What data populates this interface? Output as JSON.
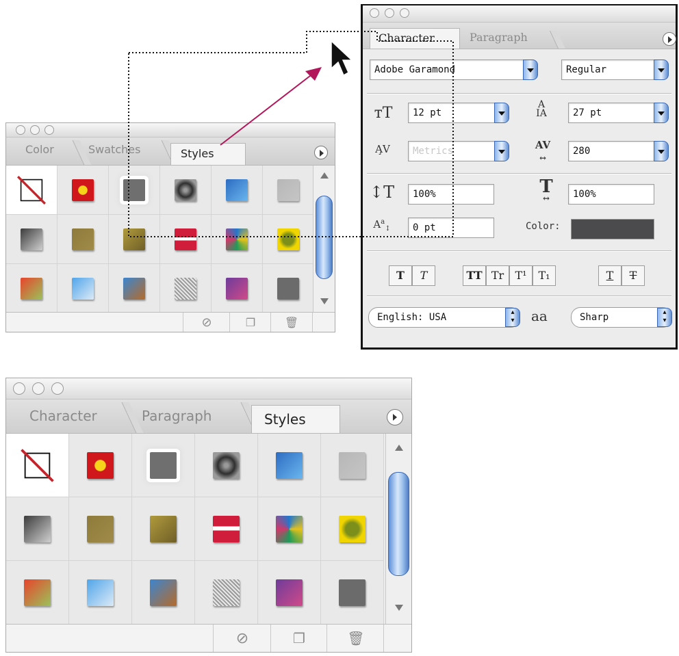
{
  "top_styles_panel": {
    "tabs": [
      "Color",
      "Swatches",
      "Styles"
    ],
    "active_tab": "Styles"
  },
  "character_panel": {
    "tabs": [
      "Character",
      "Paragraph"
    ],
    "active_tab": "Character",
    "font_family": "Adobe Garamond",
    "font_style": "Regular",
    "font_size": "12 pt",
    "leading": "27 pt",
    "kerning": "Metrics",
    "tracking": "280",
    "vertical_scale": "100%",
    "horizontal_scale": "100%",
    "baseline_shift": "0 pt",
    "color_label": "Color:",
    "color_value": "#4b4b4d",
    "type_buttons": [
      "T",
      "T",
      "TT",
      "Tr",
      "T¹",
      "T₁",
      "T",
      "T"
    ],
    "language": "English: USA",
    "aa_glyph": "aa",
    "anti_alias": "Sharp"
  },
  "bottom_styles_panel": {
    "tabs": [
      "Character",
      "Paragraph",
      "Styles"
    ],
    "active_tab": "Styles"
  },
  "styles": [
    {
      "name": "none",
      "colors": [
        "#ffffff",
        "#ffffff"
      ]
    },
    {
      "name": "red-yellow",
      "colors": [
        "#d0181c",
        "#f5d41a"
      ]
    },
    {
      "name": "gray-glow",
      "colors": [
        "#6f6f6f",
        "#6f6f6f"
      ]
    },
    {
      "name": "dark-chrome",
      "colors": [
        "#2f2f2f",
        "#9a9a9a"
      ]
    },
    {
      "name": "blue-bevel",
      "colors": [
        "#2d6cc2",
        "#6ab6ee"
      ]
    },
    {
      "name": "light-gray",
      "colors": [
        "#b7b7b7",
        "#c5c5c5"
      ]
    },
    {
      "name": "gray-gradient",
      "colors": [
        "#3c3c3c",
        "#cfcfcf"
      ]
    },
    {
      "name": "olive",
      "colors": [
        "#8e7a3a",
        "#a08b4a"
      ]
    },
    {
      "name": "olive-gradient",
      "colors": [
        "#b09a3c",
        "#6f5f28"
      ]
    },
    {
      "name": "red-stripe",
      "colors": [
        "#d11d3c",
        "#e24a5e"
      ]
    },
    {
      "name": "multicolor",
      "colors": [
        "#2277cc",
        "#e6c21b"
      ]
    },
    {
      "name": "yellow-green",
      "colors": [
        "#f0d500",
        "#7c8f1b"
      ]
    },
    {
      "name": "red-orange",
      "colors": [
        "#e8442c",
        "#9ac25a"
      ]
    },
    {
      "name": "sky-blue",
      "colors": [
        "#4fa5ea",
        "#dceaf6"
      ]
    },
    {
      "name": "landscape",
      "colors": [
        "#3a86d0",
        "#b56b2a"
      ]
    },
    {
      "name": "noise",
      "colors": [
        "#9a9a9a",
        "#e8e8e8"
      ]
    },
    {
      "name": "purple-stripe",
      "colors": [
        "#6e3c9a",
        "#d04a8a"
      ]
    },
    {
      "name": "dark-gray",
      "colors": [
        "#6b6b6b",
        "#6b6b6b"
      ]
    }
  ],
  "accent_arrow_color": "#b3165a"
}
